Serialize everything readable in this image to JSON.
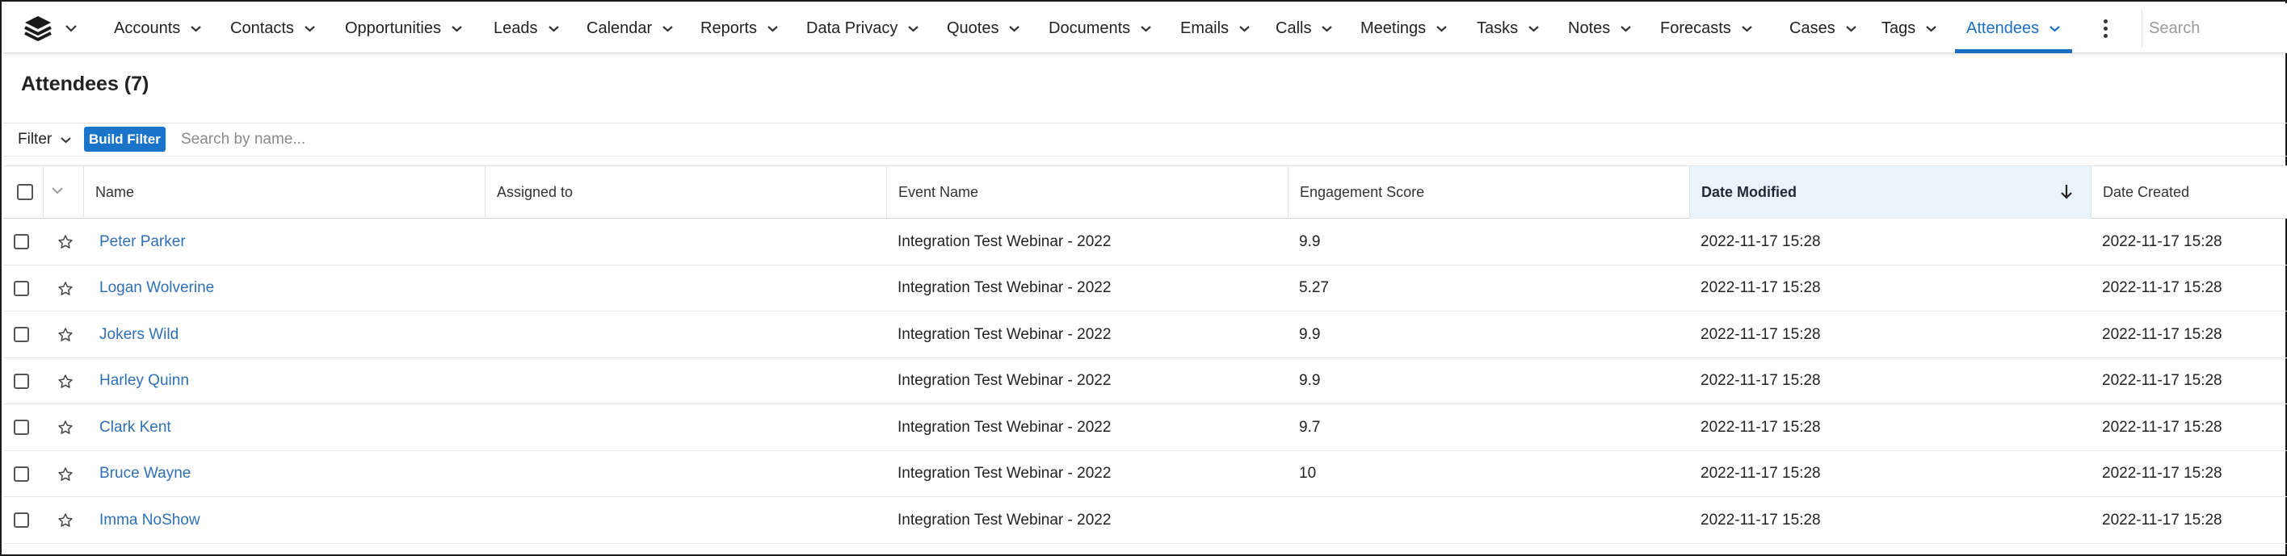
{
  "nav": {
    "items": [
      {
        "label": "Accounts"
      },
      {
        "label": "Contacts"
      },
      {
        "label": "Opportunities"
      },
      {
        "label": "Leads"
      },
      {
        "label": "Calendar"
      },
      {
        "label": "Reports"
      },
      {
        "label": "Data Privacy"
      },
      {
        "label": "Quotes"
      },
      {
        "label": "Documents"
      },
      {
        "label": "Emails"
      },
      {
        "label": "Calls"
      },
      {
        "label": "Meetings"
      },
      {
        "label": "Tasks"
      },
      {
        "label": "Notes"
      },
      {
        "label": "Forecasts"
      },
      {
        "label": "Cases"
      },
      {
        "label": "Tags"
      },
      {
        "label": "Attendees",
        "active": true
      }
    ],
    "search_placeholder": "Search",
    "accent_color": "#1a6fc4"
  },
  "page": {
    "title": "Attendees (7)"
  },
  "filter": {
    "label": "Filter",
    "build_button": "Build Filter",
    "search_placeholder": "Search by name..."
  },
  "table": {
    "columns": {
      "name": "Name",
      "assigned_to": "Assigned to",
      "event_name": "Event Name",
      "engagement_score": "Engagement Score",
      "date_modified": "Date Modified",
      "date_created": "Date Created"
    },
    "sorted_column": "Date Modified",
    "sort_direction": "descending",
    "rows": [
      {
        "name": "Peter Parker",
        "assigned_to": "",
        "event": "Integration Test Webinar - 2022",
        "score": "9.9",
        "modified": "2022-11-17 15:28",
        "created": "2022-11-17 15:28"
      },
      {
        "name": "Logan Wolverine",
        "assigned_to": "",
        "event": "Integration Test Webinar - 2022",
        "score": "5.27",
        "modified": "2022-11-17 15:28",
        "created": "2022-11-17 15:28"
      },
      {
        "name": "Jokers Wild",
        "assigned_to": "",
        "event": "Integration Test Webinar - 2022",
        "score": "9.9",
        "modified": "2022-11-17 15:28",
        "created": "2022-11-17 15:28"
      },
      {
        "name": "Harley Quinn",
        "assigned_to": "",
        "event": "Integration Test Webinar - 2022",
        "score": "9.9",
        "modified": "2022-11-17 15:28",
        "created": "2022-11-17 15:28"
      },
      {
        "name": "Clark Kent",
        "assigned_to": "",
        "event": "Integration Test Webinar - 2022",
        "score": "9.7",
        "modified": "2022-11-17 15:28",
        "created": "2022-11-17 15:28"
      },
      {
        "name": "Bruce Wayne",
        "assigned_to": "",
        "event": "Integration Test Webinar - 2022",
        "score": "10",
        "modified": "2022-11-17 15:28",
        "created": "2022-11-17 15:28"
      },
      {
        "name": "Imma NoShow",
        "assigned_to": "",
        "event": "Integration Test Webinar - 2022",
        "score": "",
        "modified": "2022-11-17 15:28",
        "created": "2022-11-17 15:28"
      }
    ]
  }
}
